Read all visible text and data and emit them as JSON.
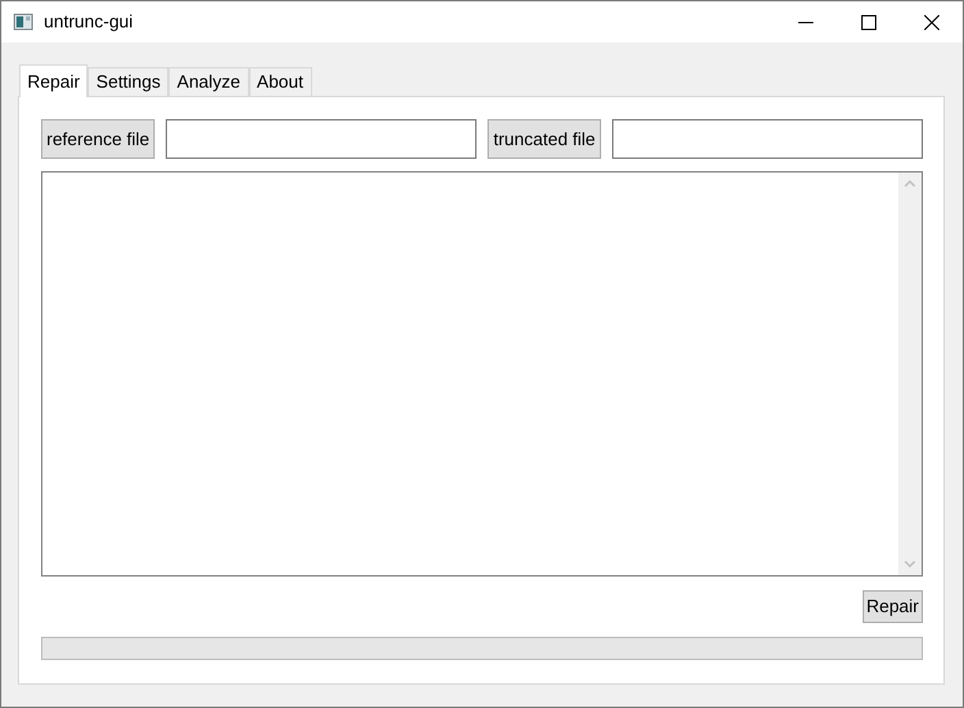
{
  "window": {
    "title": "untrunc-gui"
  },
  "tabs": [
    {
      "label": "Repair",
      "selected": true
    },
    {
      "label": "Settings",
      "selected": false
    },
    {
      "label": "Analyze",
      "selected": false
    },
    {
      "label": "About",
      "selected": false
    }
  ],
  "files": [
    {
      "button": "reference file"
    },
    {
      "button": "truncated file"
    }
  ],
  "repair_button": "Repair",
  "progress": {
    "level": 0
  }
}
